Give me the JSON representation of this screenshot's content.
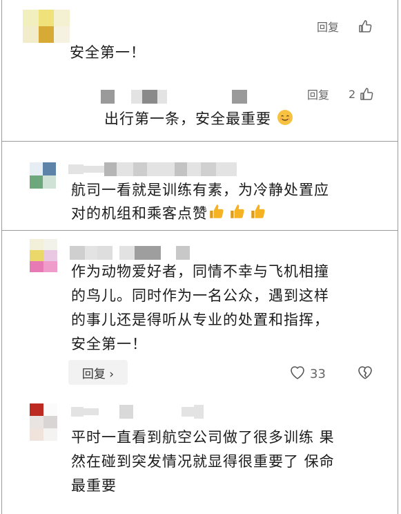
{
  "comments": [
    {
      "text": "安全第一！",
      "reply_label": "回复",
      "reply": {
        "text": "出行第一条，安全最重要",
        "reply_label": "回复",
        "like_count": "2"
      }
    },
    {
      "lines": [
        "航司一看就是训练有素，为冷静处置应",
        "对的机组和乘客点赞"
      ]
    },
    {
      "lines": [
        "作为动物爱好者，同情不幸与飞机相撞",
        "的鸟儿。同时作为一名公众，遇到这样",
        "的事儿还是得听从专业的处置和指挥，",
        "安全第一！"
      ],
      "reply_button_label": "回复 ›",
      "like_count": "33"
    },
    {
      "lines": [
        "平时一直看到航空公司做了很多训练 果",
        "然在碰到突发情况就显得很重要了 保命",
        "最重要"
      ]
    }
  ],
  "colors": {
    "thumb_emoji": "#f5b324",
    "smile_emoji": "#f7c242",
    "border": "#9a9a9a"
  }
}
